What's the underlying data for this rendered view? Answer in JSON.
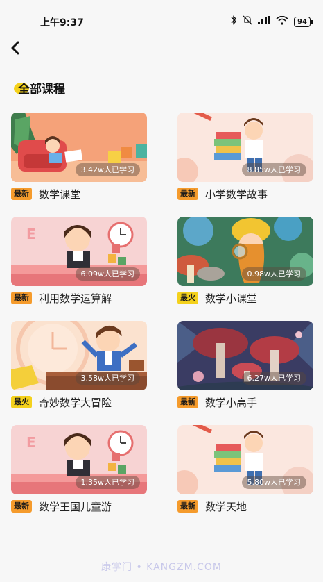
{
  "status_bar": {
    "time": "上午9:37",
    "battery": "94",
    "icons": [
      "bluetooth-icon",
      "mute-icon",
      "signal-icon",
      "wifi-icon",
      "battery-icon"
    ]
  },
  "header": {
    "back_icon": "chevron-left-icon"
  },
  "section": {
    "title": "全部课程"
  },
  "courses": [
    {
      "title": "数学课堂",
      "badge": "最新",
      "learners": "3.42w人已学习",
      "theme": "girl-reading"
    },
    {
      "title": "小学数学故事",
      "badge": "最新",
      "learners": "8.85w人已学习",
      "theme": "boy-books"
    },
    {
      "title": "利用数学运算解",
      "badge": "最新",
      "learners": "6.09w人已学习",
      "theme": "girl-clock"
    },
    {
      "title": "数学小课堂",
      "badge": "最火",
      "learners": "0.98w人已学习",
      "theme": "explorer"
    },
    {
      "title": "奇妙数学大冒险",
      "badge": "最火",
      "learners": "3.58w人已学习",
      "theme": "boy-desk"
    },
    {
      "title": "数学小高手",
      "badge": "最新",
      "learners": "6.27w人已学习",
      "theme": "mushroom-forest"
    },
    {
      "title": "数学王国儿童游",
      "badge": "最新",
      "learners": "1.35w人已学习",
      "theme": "girl-clock"
    },
    {
      "title": "数学天地",
      "badge": "最新",
      "learners": "5.80w人已学习",
      "theme": "boy-books"
    }
  ],
  "colors": {
    "badge_new": "#f59b2c",
    "badge_hot": "#f4d11c",
    "accent": "#f4d11c",
    "background": "#f7f7f7"
  },
  "watermark": "康掌门 • KANGZM.COM"
}
